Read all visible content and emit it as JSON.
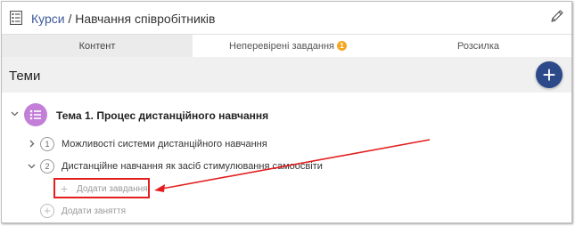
{
  "header": {
    "breadcrumb_link": "Курси",
    "breadcrumb_sep": " / ",
    "breadcrumb_current": "Навчання співробітників"
  },
  "tabs": [
    {
      "label": "Контент",
      "active": true
    },
    {
      "label": "Неперевірені завдання",
      "badge": "1"
    },
    {
      "label": "Розсилка"
    }
  ],
  "topics": {
    "title": "Теми",
    "add_button": "+",
    "items": [
      {
        "label": "Тема 1. Процес дистанційного навчання",
        "lessons": [
          {
            "number": "1",
            "label": "Можливості системи дистанційного навчання"
          },
          {
            "number": "2",
            "label": "Дистанційне навчання як засіб стимулювання самоосвіти"
          }
        ],
        "add_task": "Додати завдання",
        "add_lesson": "Додати заняття"
      }
    ]
  },
  "colors": {
    "accent": "#2c4a8a",
    "topic_icon": "#c37fd8",
    "badge": "#f5a623",
    "annotation": "#e41e1e"
  },
  "icons": {
    "document": "document-list-icon",
    "edit": "pencil-icon",
    "topic": "list-icon"
  }
}
